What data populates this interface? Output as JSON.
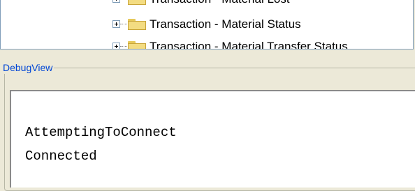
{
  "tree": {
    "items": [
      {
        "label": "Transaction - Material Lost"
      },
      {
        "label": "Transaction - Material Status"
      },
      {
        "label": "Transaction - Material Transfer Status"
      }
    ]
  },
  "debug_view": {
    "title": "DebugView",
    "lines": [
      "AttemptingToConnect",
      "Connected"
    ]
  },
  "colors": {
    "background": "#ece9d8",
    "title_text": "#0046d5",
    "folder_fill": "#f3dc82"
  },
  "icons": {
    "expander": "plus-box-icon",
    "folder": "folder-icon"
  }
}
